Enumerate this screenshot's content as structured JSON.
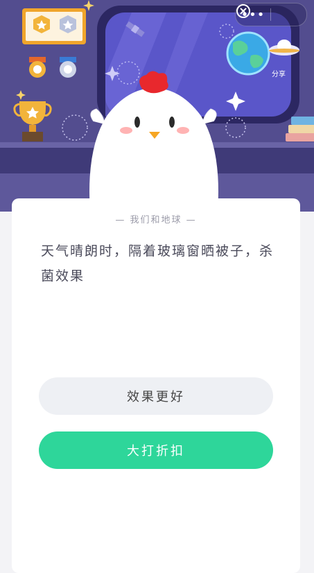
{
  "capsule": {
    "more_label": "•••"
  },
  "scene": {
    "share_label": "分享"
  },
  "card": {
    "subtitle": "— 我们和地球 —",
    "question": "天气晴朗时，隔着玻璃窗晒被子，杀菌效果",
    "options": [
      {
        "label": "效果更好"
      },
      {
        "label": "大打折扣"
      }
    ]
  },
  "colors": {
    "accent": "#2ed69a",
    "scene_bg": "#4f4a8a"
  }
}
